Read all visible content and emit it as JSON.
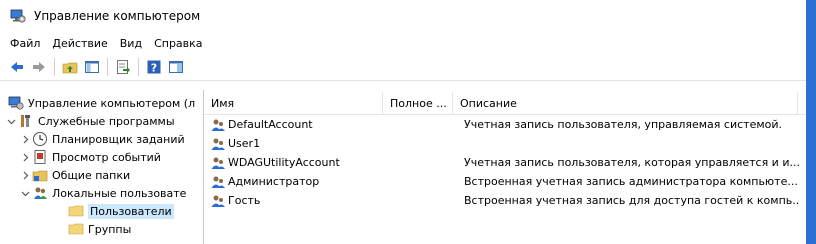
{
  "window": {
    "title": "Управление компьютером"
  },
  "menu": [
    "Файл",
    "Действие",
    "Вид",
    "Справка"
  ],
  "toolbar": {
    "icons": [
      "back-icon",
      "forward-icon",
      "up-folder-icon",
      "show-hide-tree-icon",
      "export-list-icon",
      "help-icon",
      "properties-icon"
    ]
  },
  "tree": [
    {
      "label": "Управление компьютером (л",
      "icon": "computer-management-icon",
      "chevron": "",
      "indent": 0
    },
    {
      "label": "Служебные программы",
      "icon": "tools-icon",
      "chevron": "v",
      "indent": 1
    },
    {
      "label": "Планировщик заданий",
      "icon": "clock-icon",
      "chevron": ">",
      "indent": 2
    },
    {
      "label": "Просмотр событий",
      "icon": "event-viewer-icon",
      "chevron": ">",
      "indent": 2
    },
    {
      "label": "Общие папки",
      "icon": "shared-folder-icon",
      "chevron": ">",
      "indent": 2
    },
    {
      "label": "Локальные пользовате",
      "icon": "users-group-icon",
      "chevron": "v",
      "indent": 2
    },
    {
      "label": "Пользователи",
      "icon": "folder-icon",
      "chevron": "",
      "indent": 3,
      "selected": true
    },
    {
      "label": "Группы",
      "icon": "folder-icon",
      "chevron": "",
      "indent": 3
    }
  ],
  "columns": [
    "Имя",
    "Полное ...",
    "Описание"
  ],
  "users": [
    {
      "name": "DefaultAccount",
      "full": "",
      "desc": "Учетная запись пользователя, управляемая системой."
    },
    {
      "name": "User1",
      "full": "",
      "desc": ""
    },
    {
      "name": "WDAGUtilityAccount",
      "full": "",
      "desc": "Учетная запись пользователя, которая управляется и и..."
    },
    {
      "name": "Администратор",
      "full": "",
      "desc": "Встроенная учетная запись администратора компьюте..."
    },
    {
      "name": "Гость",
      "full": "",
      "desc": "Встроенная учетная запись для доступа гостей к компь..."
    }
  ]
}
